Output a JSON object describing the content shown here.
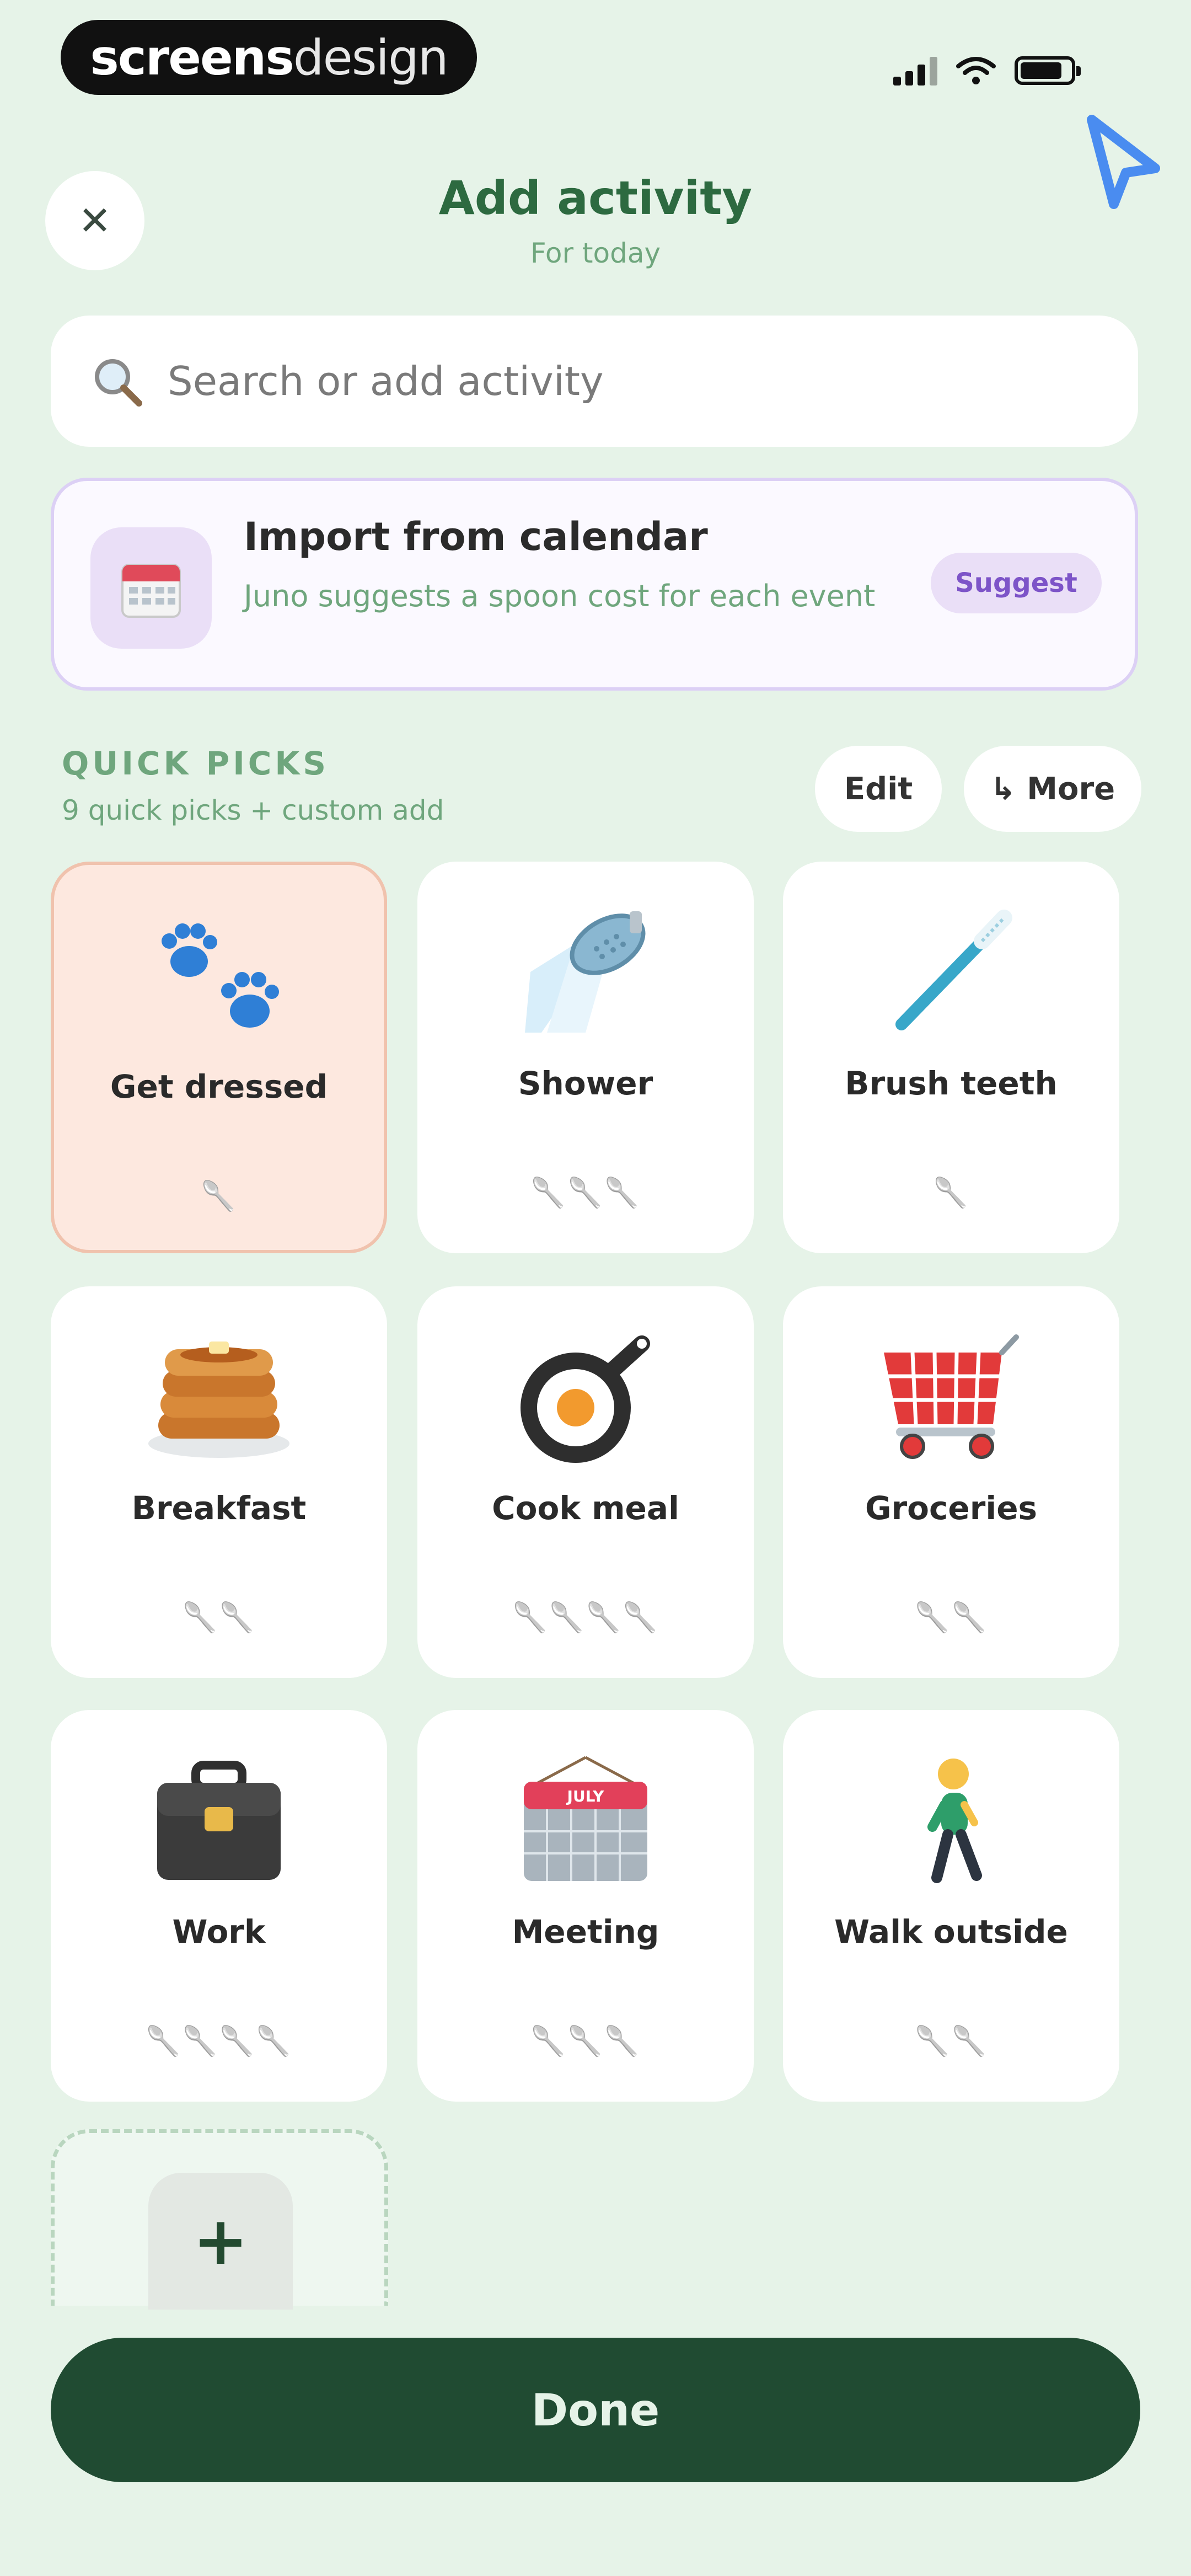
{
  "status_bar": {
    "brand_bold": "screens",
    "brand_light": "design"
  },
  "header": {
    "title": "Add activity",
    "subtitle": "For today",
    "close_glyph": "✕"
  },
  "search": {
    "placeholder": "Search or add activity"
  },
  "import": {
    "title": "Import from calendar",
    "description": "Juno suggests a spoon cost for each event",
    "badge": "Suggest"
  },
  "quick_picks": {
    "label": "QUICK PICKS",
    "sublabel": "9 quick picks + custom add",
    "edit_label": "Edit",
    "more_label": "↳ More",
    "items": [
      {
        "name": "Get dressed",
        "cost": "🥄",
        "icon": "paw-prints-icon",
        "selected": true
      },
      {
        "name": "Shower",
        "cost": "🥄🥄🥄",
        "icon": "shower-icon"
      },
      {
        "name": "Brush teeth",
        "cost": "🥄",
        "icon": "toothbrush-icon"
      },
      {
        "name": "Breakfast",
        "cost": "🥄🥄",
        "icon": "pancakes-icon"
      },
      {
        "name": "Cook meal",
        "cost": "🥄🥄🥄🥄",
        "icon": "frying-pan-icon"
      },
      {
        "name": "Groceries",
        "cost": "🥄🥄",
        "icon": "shopping-cart-icon"
      },
      {
        "name": "Work",
        "cost": "🥄🥄🥄🥄",
        "icon": "briefcase-icon"
      },
      {
        "name": "Meeting",
        "cost": "🥄🥄🥄",
        "icon": "calendar-icon",
        "calendar_month": "JULY"
      },
      {
        "name": "Walk outside",
        "cost": "🥄🥄",
        "icon": "walking-person-icon"
      }
    ],
    "add_glyph": "+"
  },
  "done_label": "Done",
  "colors": {
    "accent": "#204b32",
    "title_green": "#2d6a40",
    "muted_green": "#6fa67d",
    "suggest_purple": "#7d54c8"
  }
}
